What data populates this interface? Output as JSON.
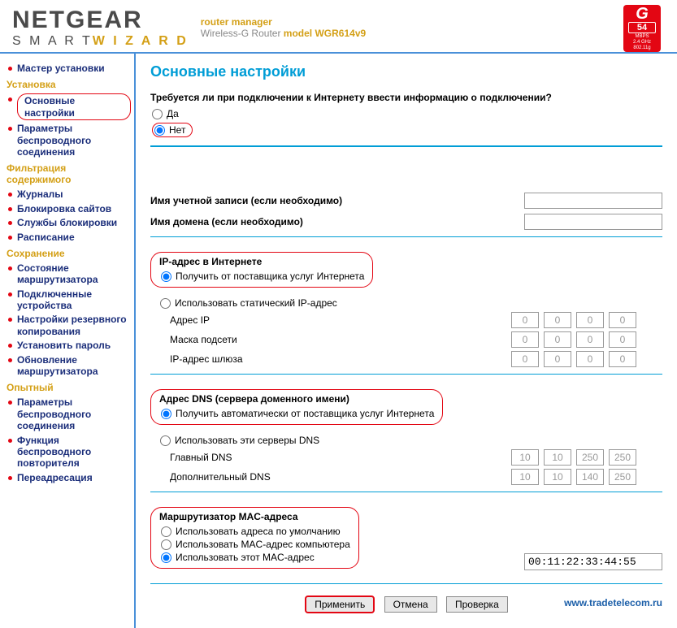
{
  "header": {
    "logo_main": "NETGEAR",
    "logo_smart": "S M A R T",
    "logo_wizard": "W I Z A R D",
    "tagline1": "router manager",
    "tagline2_a": "Wireless-G Router",
    "tagline2_b": "model WGR614v9",
    "badge_g": "G",
    "badge_speed": "54",
    "badge_unit": "MBPS",
    "badge_freq": "2.4 GHz",
    "badge_std": "802.11g"
  },
  "sidebar": {
    "top_items": [
      {
        "label": "Мастер установки"
      }
    ],
    "sections": [
      {
        "title": "Установка",
        "items": [
          {
            "label": "Основные настройки",
            "highlighted": true
          },
          {
            "label": "Параметры беспроводного соединения"
          }
        ]
      },
      {
        "title": "Фильтрация содержимого",
        "items": [
          {
            "label": "Журналы"
          },
          {
            "label": "Блокировка сайтов"
          },
          {
            "label": "Службы блокировки"
          },
          {
            "label": "Расписание"
          }
        ]
      },
      {
        "title": "Сохранение",
        "items": [
          {
            "label": "Состояние маршрутизатора"
          },
          {
            "label": "Подключенные устройства"
          },
          {
            "label": "Настройки резервного копирования"
          },
          {
            "label": "Установить пароль"
          },
          {
            "label": "Обновление маршрутизатора"
          }
        ]
      },
      {
        "title": "Опытный",
        "items": [
          {
            "label": "Параметры беспроводного соединения"
          },
          {
            "label": "Функция беспроводного повторителя"
          },
          {
            "label": "Переадресация"
          }
        ]
      }
    ]
  },
  "content": {
    "page_title": "Основные настройки",
    "question": "Требуется ли при подключении к Интернету ввести информацию о подключении?",
    "opt_yes": "Да",
    "opt_no": "Нет",
    "account_label": "Имя учетной записи  (если необходимо)",
    "account_value": "",
    "domain_label": "Имя домена  (если необходимо)",
    "domain_value": "",
    "ip_section": {
      "heading": "IP-адрес в Интернете",
      "opt_isp": "Получить от поставщика услуг Интернета",
      "opt_static": "Использовать статический IP-адрес",
      "row_ip": "Адрес IP",
      "row_mask": "Маска подсети",
      "row_gw": "IP-адрес шлюза",
      "ip": [
        "0",
        "0",
        "0",
        "0"
      ],
      "mask": [
        "0",
        "0",
        "0",
        "0"
      ],
      "gw": [
        "0",
        "0",
        "0",
        "0"
      ]
    },
    "dns_section": {
      "heading": "Адрес DNS (сервера доменного имени)",
      "opt_auto": "Получить автоматически от поставщика услуг Интернета",
      "opt_manual": "Использовать эти серверы DNS",
      "row_primary": "Главный DNS",
      "row_secondary": "Дополнительный DNS",
      "primary": [
        "10",
        "10",
        "250",
        "250"
      ],
      "secondary": [
        "10",
        "10",
        "140",
        "250"
      ]
    },
    "mac_section": {
      "heading": "Маршрутизатор MAC-адреса",
      "opt_default": "Использовать адреса по умолчанию",
      "opt_computer": "Использовать MAC-адрес компьютера",
      "opt_this": "Использовать этот MAC-адрес",
      "mac_value": "00:11:22:33:44:55"
    },
    "buttons": {
      "apply": "Применить",
      "cancel": "Отмена",
      "test": "Проверка"
    },
    "footer_link": "www.tradetelecom.ru"
  }
}
